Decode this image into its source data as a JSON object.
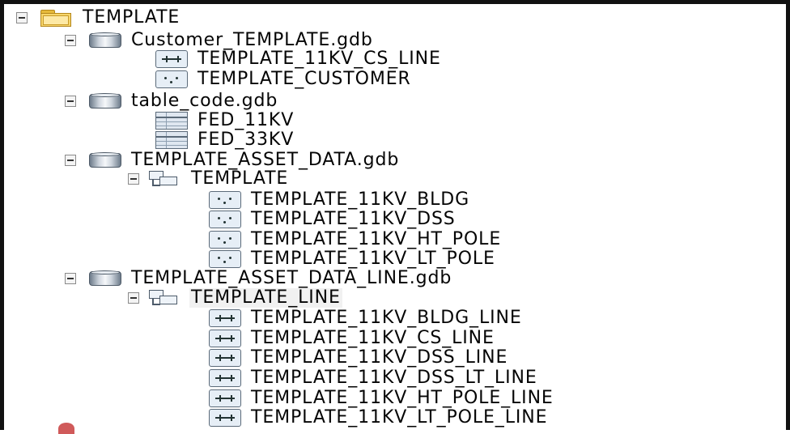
{
  "tree": {
    "root": {
      "label": "TEMPLATE",
      "icon": "folder-icon"
    },
    "customer_gdb": {
      "label": "Customer_TEMPLATE.gdb",
      "icon": "geodatabase-icon",
      "children": [
        {
          "label": "TEMPLATE_11KV_CS_LINE",
          "icon": "line-feature-class-icon"
        },
        {
          "label": "TEMPLATE_CUSTOMER",
          "icon": "point-feature-class-icon"
        }
      ]
    },
    "table_code_gdb": {
      "label": "table_code.gdb",
      "icon": "geodatabase-icon",
      "children": [
        {
          "label": "FED_11KV",
          "icon": "table-icon"
        },
        {
          "label": "FED_33KV",
          "icon": "table-icon"
        }
      ]
    },
    "asset_data_gdb": {
      "label": "TEMPLATE_ASSET_DATA.gdb",
      "icon": "geodatabase-icon",
      "dataset": {
        "label": "TEMPLATE",
        "icon": "feature-dataset-icon",
        "children": [
          {
            "label": "TEMPLATE_11KV_BLDG",
            "icon": "point-feature-class-icon"
          },
          {
            "label": "TEMPLATE_11KV_DSS",
            "icon": "point-feature-class-icon"
          },
          {
            "label": "TEMPLATE_11KV_HT_POLE",
            "icon": "point-feature-class-icon"
          },
          {
            "label": "TEMPLATE_11KV_LT_POLE",
            "icon": "point-feature-class-icon"
          }
        ]
      }
    },
    "asset_data_line_gdb": {
      "label": "TEMPLATE_ASSET_DATA_LINE.gdb",
      "icon": "geodatabase-icon",
      "dataset": {
        "label": "TEMPLATE_LINE",
        "icon": "feature-dataset-icon",
        "selected": true,
        "children": [
          {
            "label": "TEMPLATE_11KV_BLDG_LINE",
            "icon": "line-feature-class-icon"
          },
          {
            "label": "TEMPLATE_11KV_CS_LINE",
            "icon": "line-feature-class-icon"
          },
          {
            "label": "TEMPLATE_11KV_DSS_LINE",
            "icon": "line-feature-class-icon"
          },
          {
            "label": "TEMPLATE_11KV_DSS_LT_LINE",
            "icon": "line-feature-class-icon"
          },
          {
            "label": "TEMPLATE_11KV_HT_POLE_LINE",
            "icon": "line-feature-class-icon"
          },
          {
            "label": "TEMPLATE_11KV_LT_POLE_LINE",
            "icon": "line-feature-class-icon"
          }
        ]
      }
    }
  }
}
